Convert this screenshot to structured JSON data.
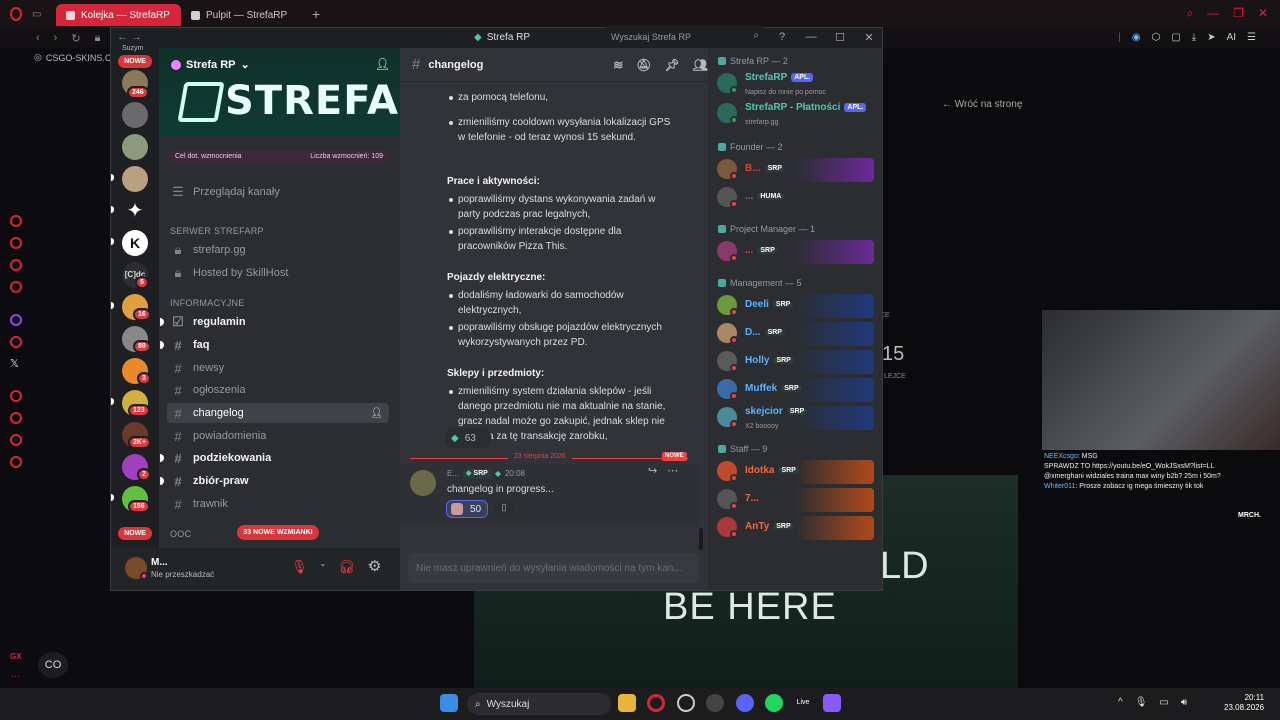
{
  "browser": {
    "tabs": [
      {
        "label": "Kolejka — StrefaRP",
        "active": true
      },
      {
        "label": "Pulpit — StrefaRP",
        "active": false
      }
    ],
    "new_tab": "+",
    "bookmark": "CSGO-SKINS.CO",
    "toolbar_ai": "AI"
  },
  "discord": {
    "window_title": "Strefa RP",
    "rail": {
      "top_label": "Suzym",
      "nowe_top": "NOWE",
      "nowe_bottom": "NOWE",
      "badges": [
        "246",
        "5",
        "16",
        "89",
        "3",
        "123",
        "2K+",
        "2",
        "156"
      ],
      "cdc_label": "[C]dc"
    },
    "server": {
      "name": "Strefa RP",
      "banner_text": "STREFA",
      "boost_goal": "Cel dot. wzmocnienia",
      "boost_count": "Liczba wzmocnień: 109",
      "browse_channels": "Przeglądaj kanały"
    },
    "categories": [
      {
        "label": "SERWER STREFARP"
      },
      {
        "label": "INFORMACYJNE"
      },
      {
        "label": "OOC"
      }
    ],
    "channels": [
      {
        "name": "strefarp.gg",
        "locked": true
      },
      {
        "name": "Hosted by SkillHost",
        "locked": true
      },
      {
        "name": "regulamin",
        "unread": true
      },
      {
        "name": "faq",
        "unread": true
      },
      {
        "name": "newsy"
      },
      {
        "name": "ogłoszenia"
      },
      {
        "name": "changelog",
        "selected": true
      },
      {
        "name": "powiadomienia"
      },
      {
        "name": "podziekowania",
        "unread": true
      },
      {
        "name": "zbiór-praw",
        "unread": true
      },
      {
        "name": "trawnik"
      }
    ],
    "new_mentions": "33 NOWE WZMIANKI",
    "user": {
      "name": "M...",
      "status": "Nie przeszkadzać"
    },
    "chat": {
      "channel_name": "changelog",
      "search_placeholder": "Wyszukaj Strefa RP",
      "top_fragment": "za pomocą telefonu,",
      "top_bullet": "zmieniliśmy cooldown wysyłania lokalizacji GPS w telefonie - od teraz wynosi 15 sekund.",
      "sections": [
        {
          "title": "Prace i aktywności:",
          "items": [
            "poprawiliśmy dystans wykonywania zadań w party podczas prac legalnych,",
            "poprawiliśmy interakcje dostępne dla pracowników Pizza This."
          ]
        },
        {
          "title": "Pojazdy elektryczne:",
          "items": [
            "dodaliśmy ładowarki do samochodów elektrycznych,",
            "poprawiliśmy obsługę pojazdów elektrycznych wykorzystywanych przez PD."
          ]
        },
        {
          "title": "Sklepy i przedmioty:",
          "items": [
            "zmieniliśmy system działania sklepów - jeśli danego przedmiotu nie ma aktualnie na stanie, gracz nadal może go zakupić, jednak sklep nie otrzyma za tę transakcję zarobku,"
          ]
        }
      ],
      "reaction1_count": "63",
      "divider_date": "23 sierpnia 2026",
      "divider_new": "NOWE",
      "msg2": {
        "author": "E...",
        "tag": "SRP",
        "time": "20:08",
        "text": "changelog in progress...",
        "reaction_count": "50"
      },
      "composer_placeholder": "Nie masz uprawnień do wysyłania wiadomości na tym kan..."
    },
    "members": {
      "groups": [
        {
          "title": "Strefa RP — 2",
          "members": [
            {
              "name": "StrefaRP",
              "tag": "APL.",
              "sub": "Napisz do mnie po pomoc",
              "color": "#4cc9b0"
            },
            {
              "name": "StrefaRP - Płatności",
              "tag": "APL.",
              "sub": "strefarp.gg",
              "color": "#4cc9b0"
            }
          ]
        },
        {
          "title": "Founder — 2",
          "members": [
            {
              "name": "B...",
              "tag": "SRP",
              "color": "#e04040"
            },
            {
              "name": "...",
              "tag": "HUMA",
              "color": "#777777"
            }
          ]
        },
        {
          "title": "Project Manager — 1",
          "members": [
            {
              "name": "...",
              "tag": "SRP",
              "color": "#e04040"
            }
          ]
        },
        {
          "title": "Management — 5",
          "members": [
            {
              "name": "Deeli",
              "tag": "SRP",
              "color": "#5ab4ff"
            },
            {
              "name": "D...",
              "tag": "SRP",
              "color": "#5ab4ff"
            },
            {
              "name": "Holly",
              "tag": "SRP",
              "color": "#5ab4ff"
            },
            {
              "name": "Muffek",
              "tag": "SRP",
              "color": "#5ab4ff"
            },
            {
              "name": "skejcior",
              "tag": "SRP",
              "sub": "X2 booooy",
              "color": "#5ab4ff"
            }
          ]
        },
        {
          "title": "Staff — 9",
          "members": [
            {
              "name": "Idotka",
              "tag": "SRP",
              "color": "#f06a3a"
            },
            {
              "name": "7...",
              "tag": "",
              "color": "#f06a3a"
            },
            {
              "name": "AnTy",
              "tag": "SRP",
              "color": "#f06a3a"
            }
          ]
        }
      ]
    }
  },
  "background": {
    "back_link": "← Wróć na stronę",
    "big_text_line1": "LD",
    "big_text_line2": "BE HERE",
    "number": "15",
    "ce_label": "CE",
    "lejce_label": "LEJCE",
    "overlay_chat": [
      {
        "user": "NEEXcsgo",
        "text": "MSG"
      },
      {
        "user": "",
        "text": "SPRAWDZ TO https://youtu.be/eO_WokJSxsM?list=LL"
      },
      {
        "user": "",
        "text": "@xmerghani widziales traina max winy b2b? 25m i 50m?"
      },
      {
        "user": "Whiter011",
        "text": "Prosze zobacz ig mega śmieszny tik tok"
      }
    ],
    "overlay_brand": "MRCH."
  },
  "taskbar": {
    "search": "Wyszukaj",
    "time": "20:11",
    "date": "23.08.2026",
    "live_label": "Live"
  }
}
